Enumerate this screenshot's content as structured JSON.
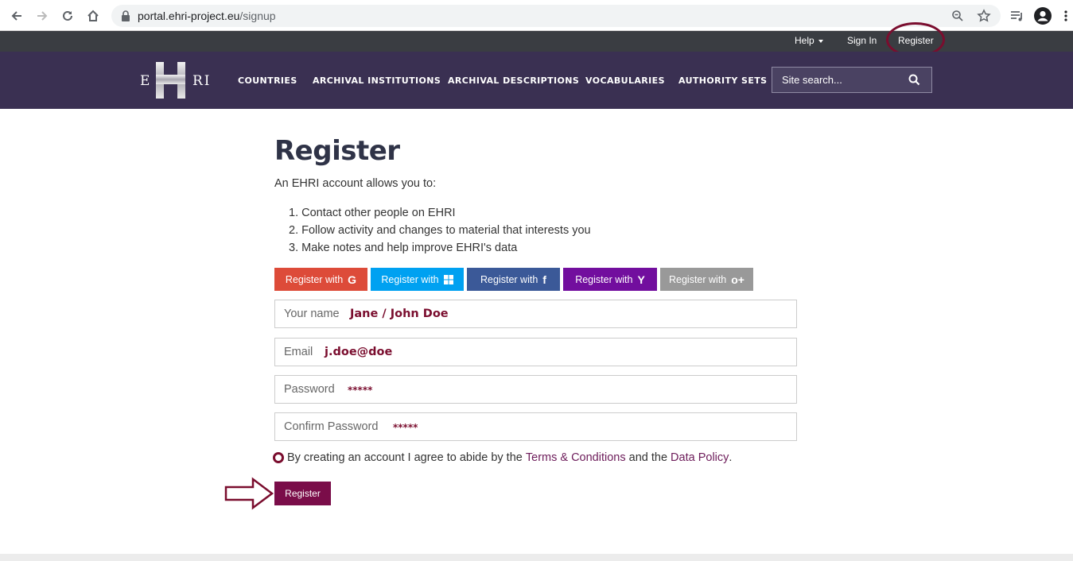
{
  "browser": {
    "url_host": "portal.ehri-project.eu",
    "url_path": "/signup"
  },
  "utility_nav": {
    "help": "Help",
    "sign_in": "Sign In",
    "register": "Register"
  },
  "main_nav": {
    "logo_text": "EHRI",
    "items": [
      "COUNTRIES",
      "ARCHIVAL INSTITUTIONS",
      "ARCHIVAL DESCRIPTIONS",
      "VOCABULARIES",
      "AUTHORITY SETS"
    ],
    "search_placeholder": "Site search..."
  },
  "page": {
    "title": "Register",
    "intro": "An EHRI account allows you to:",
    "benefits": [
      "1. Contact other people on EHRI",
      "2. Follow activity and changes to material that interests you",
      "3. Make notes and help improve EHRI's data"
    ]
  },
  "oauth": [
    {
      "label": "Register with",
      "icon": "G",
      "icon_name": "google-icon",
      "color": "#dd4b39"
    },
    {
      "label": "Register with",
      "icon": "⊞",
      "icon_name": "windows-icon",
      "color": "#00a1f1"
    },
    {
      "label": "Register with",
      "icon": "f",
      "icon_name": "facebook-icon",
      "color": "#3b5998"
    },
    {
      "label": "Register with",
      "icon": "Y",
      "icon_name": "yahoo-icon",
      "color": "#720e9e"
    },
    {
      "label": "Register with",
      "icon": "o+",
      "icon_name": "openid-icon",
      "color": "#999999"
    }
  ],
  "form": {
    "name_label": "Your name",
    "name_value": "Jane / John Doe",
    "email_label": "Email",
    "email_value": "j.doe@doe",
    "password_label": "Password",
    "password_value": "*****",
    "confirm_label": "Confirm Password",
    "confirm_value": "*****",
    "agree_prefix": "By creating an account I agree to abide by the",
    "terms_link": "Terms & Conditions",
    "agree_middle": "and the",
    "policy_link": "Data Policy",
    "agree_suffix": ".",
    "submit_label": "Register"
  },
  "colors": {
    "utility_bar": "#3a3d42",
    "nav_bar": "#3a3052",
    "accent": "#7a0d2e",
    "submit": "#7a0d49"
  }
}
